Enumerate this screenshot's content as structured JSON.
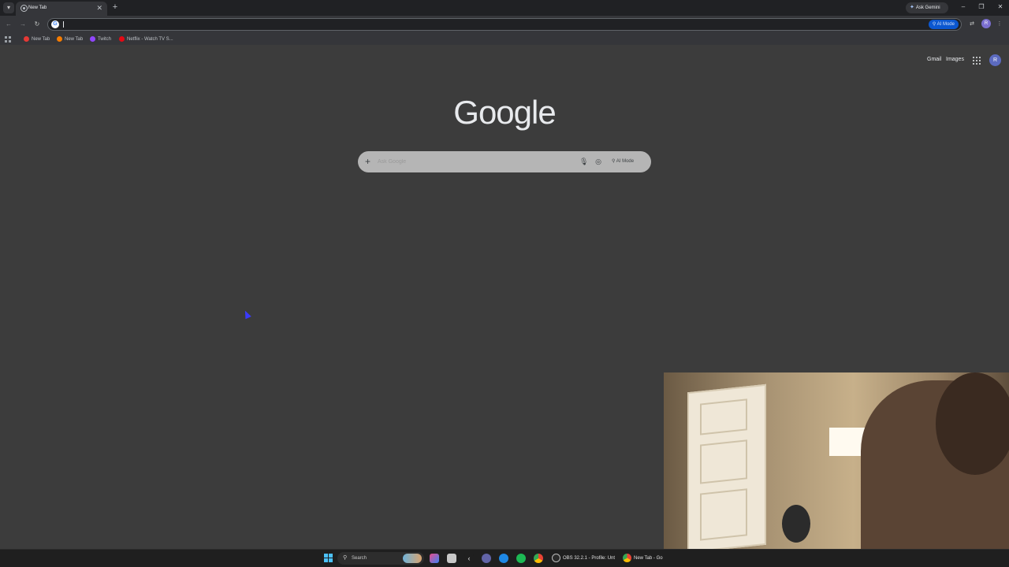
{
  "browser": {
    "tab": {
      "title": "New Tab",
      "close": "✕"
    },
    "new_tab_symbol": "+",
    "ask_gemini": "Ask Gemini",
    "window_controls": {
      "minimize": "–",
      "restore": "❐",
      "close": "✕"
    },
    "omnibox": {
      "value": "",
      "placeholder": "",
      "ai_mode": "AI Mode"
    },
    "profile_initial": "R",
    "bookmarks": [
      {
        "label": "New Tab",
        "color": "#e53935"
      },
      {
        "label": "New Tab",
        "color": "#f57c00"
      },
      {
        "label": "Twitch",
        "color": "#9146ff"
      },
      {
        "label": "Netflix - Watch TV S...",
        "color": "#e50914"
      }
    ]
  },
  "page": {
    "links": {
      "gmail": "Gmail",
      "images": "Images"
    },
    "account_initial": "R",
    "logo": "Google",
    "search": {
      "placeholder": "Ask Google",
      "ai_mode": "AI Mode"
    }
  },
  "taskbar": {
    "search_label": "Search",
    "running": [
      {
        "label": "OBS 32.2.1 - Profile: Unt",
        "color": "#2a2a2a"
      },
      {
        "label": "New Tab - Go",
        "color": "#34a853"
      }
    ]
  },
  "colors": {
    "page_bg": "#3c3c3c",
    "toolbar_bg": "#35363a",
    "accent": "#0b57d0"
  }
}
